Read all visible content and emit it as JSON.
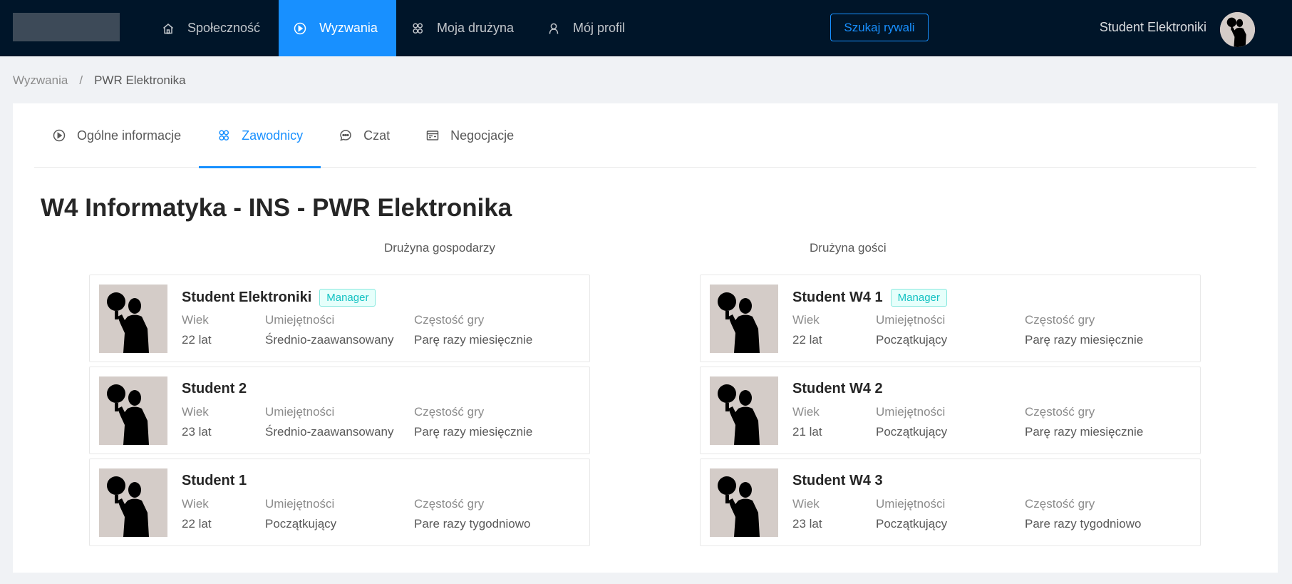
{
  "nav": {
    "items": [
      {
        "label": "Społeczność",
        "icon": "home-icon"
      },
      {
        "label": "Wyzwania",
        "icon": "play-circle-icon",
        "active": true
      },
      {
        "label": "Moja drużyna",
        "icon": "team-icon"
      },
      {
        "label": "Mój profil",
        "icon": "user-icon"
      }
    ],
    "search_button": "Szukaj rywali",
    "user_name": "Student Elektroniki"
  },
  "breadcrumb": [
    "Wyzwania",
    "/",
    "PWR Elektronika"
  ],
  "tabs": [
    {
      "label": "Ogólne informacje",
      "icon": "play-circle-icon"
    },
    {
      "label": "Zawodnicy",
      "icon": "team-icon",
      "active": true
    },
    {
      "label": "Czat",
      "icon": "message-icon"
    },
    {
      "label": "Negocjacje",
      "icon": "schedule-icon"
    }
  ],
  "match_title": "W4 Informatyka - INS - PWR Elektronika",
  "labels": {
    "age": "Wiek",
    "skill": "Umiejętności",
    "freq": "Częstość gry"
  },
  "home_team": {
    "heading": "Drużyna gospodarzy",
    "players": [
      {
        "name": "Student Elektroniki",
        "badge": "Manager",
        "age": "22 lat",
        "skill": "Średnio-zaawansowany",
        "freq": "Parę razy miesięcznie"
      },
      {
        "name": "Student 2",
        "badge": "",
        "age": "23 lat",
        "skill": "Średnio-zaawansowany",
        "freq": "Parę razy miesięcznie"
      },
      {
        "name": "Student 1",
        "badge": "",
        "age": "22 lat",
        "skill": "Początkujący",
        "freq": "Pare razy tygodniowo"
      }
    ]
  },
  "away_team": {
    "heading": "Drużyna gości",
    "players": [
      {
        "name": "Student W4 1",
        "badge": "Manager",
        "age": "22 lat",
        "skill": "Początkujący",
        "freq": "Parę razy miesięcznie"
      },
      {
        "name": "Student W4 2",
        "badge": "",
        "age": "21 lat",
        "skill": "Początkujący",
        "freq": "Parę razy miesięcznie"
      },
      {
        "name": "Student W4 3",
        "badge": "",
        "age": "23 lat",
        "skill": "Początkujący",
        "freq": "Pare razy tygodniowo"
      }
    ]
  },
  "colors": {
    "accent": "#1890ff",
    "topbar": "#001529",
    "badge": "#13c2c2"
  }
}
